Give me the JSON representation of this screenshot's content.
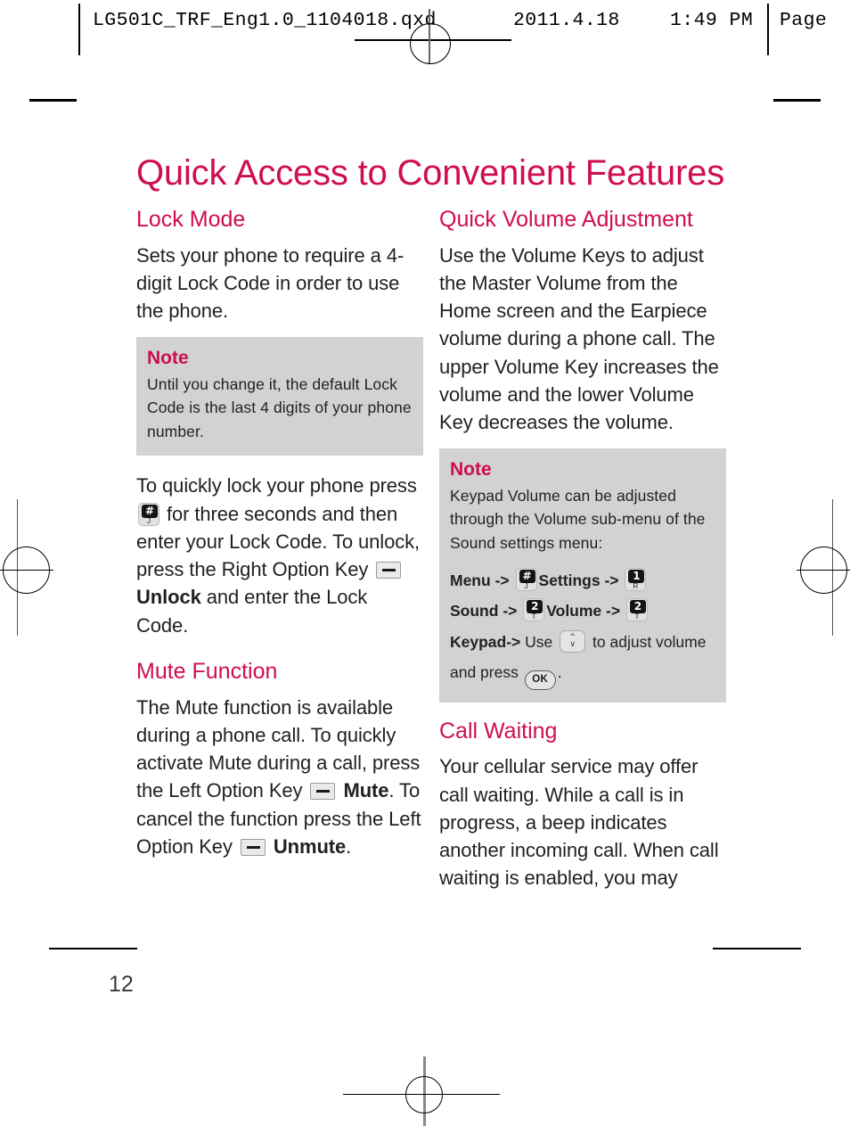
{
  "printer_header": {
    "filename": "LG501C_TRF_Eng1.0_1104018.qxd",
    "date": "2011.4.18",
    "time": "1:49 PM",
    "page_label": "Page"
  },
  "colors": {
    "heading": "#ce0e4e",
    "body_text": "#231f20",
    "note_background": "#d2d2d2"
  },
  "page": {
    "title": "Quick Access to Convenient Features",
    "page_number": "12"
  },
  "left_column": {
    "lock_mode": {
      "heading": "Lock Mode",
      "intro": "Sets your phone to require a 4-digit Lock Code in order to use the phone.",
      "note": {
        "title": "Note",
        "text": "Until you change it, the default Lock Code is the last 4 digits of your phone number."
      },
      "instructions": {
        "part1": "To quickly lock your phone press",
        "part2": "for three seconds and then enter your Lock Code. To unlock, press the Right Option Key",
        "part3_strong": "Unlock",
        "part4": "and enter the Lock Code."
      },
      "keys": {
        "hash": {
          "cap": "#",
          "sub": "J",
          "name": "hash-key-icon"
        },
        "right_option": {
          "name": "right-option-key-icon"
        }
      }
    },
    "mute_function": {
      "heading": "Mute Function",
      "text_part1": "The Mute function is available during a phone call. To quickly activate Mute during a call, press the Left Option Key",
      "mute_strong": "Mute",
      "text_part2": ". To cancel the function press the Left Option Key",
      "unmute_strong": "Unmute",
      "text_part3": "."
    }
  },
  "right_column": {
    "quick_volume": {
      "heading": "Quick Volume Adjustment",
      "text": "Use the Volume Keys to adjust the Master Volume from the Home screen and the Earpiece volume during a phone call. The upper Volume Key increases the volume and the lower Volume Key decreases the volume.",
      "note": {
        "title": "Note",
        "text": "Keypad Volume can be adjusted through the Volume sub-menu of the Sound settings menu:",
        "steps": [
          {
            "label": "Menu",
            "arrow": "->",
            "key": {
              "cap": "#",
              "sub": "J"
            },
            "target": "Settings",
            "arrow2": "->",
            "key2": {
              "cap": "1",
              "sub": "R"
            }
          },
          {
            "label": "Sound",
            "arrow": "->",
            "key": {
              "cap": "2",
              "sub": "T"
            },
            "target": "Volume",
            "arrow2": "->",
            "key2": {
              "cap": "2",
              "sub": "T"
            }
          },
          {
            "label": "Keypad",
            "arrow": "->",
            "use_text": "Use",
            "nav_key": "nav-up-down-key-icon",
            "adjust_text": "to adjust volume and press",
            "ok_key": "OK",
            "period": "."
          }
        ]
      }
    },
    "call_waiting": {
      "heading": "Call Waiting",
      "text": "Your cellular service may offer call waiting. While a call is in progress, a beep indicates another incoming call. When call waiting is enabled, you may"
    }
  }
}
